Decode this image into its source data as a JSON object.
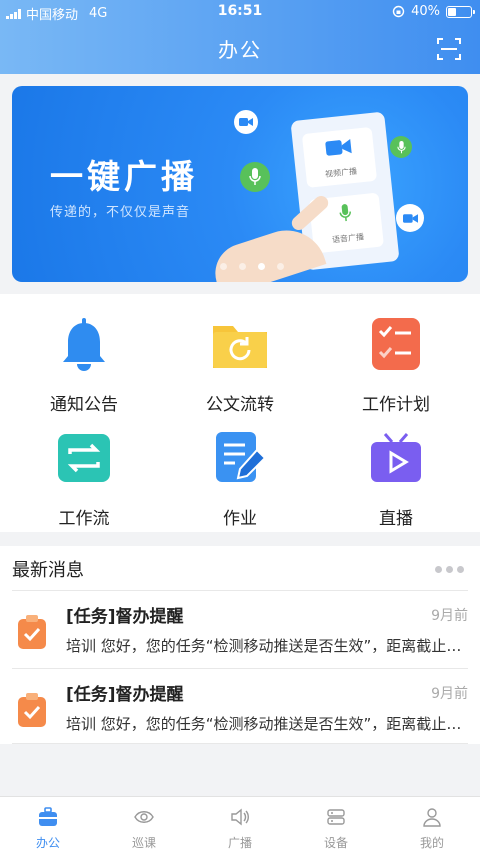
{
  "status_bar": {
    "carrier": "中国移动",
    "network": "4G",
    "time": "16:51",
    "battery": "40%",
    "battery_level": 0.4
  },
  "header": {
    "title": "办公",
    "scan_icon": "scan-icon"
  },
  "banner": {
    "title": "一键广播",
    "subtitle": "传递的，不仅仅是声音",
    "card_items": [
      "视频广播",
      "语音广播"
    ],
    "dots": 4,
    "active_dot": 2
  },
  "grid": {
    "items": [
      {
        "label": "通知公告",
        "icon": "bell-icon",
        "color": "#2f8cf0"
      },
      {
        "label": "公文流转",
        "icon": "folder-refresh-icon",
        "color": "#f7c53a"
      },
      {
        "label": "工作计划",
        "icon": "checklist-icon",
        "color": "#f36b4c"
      },
      {
        "label": "工作流",
        "icon": "workflow-icon",
        "color": "#2bc4b4"
      },
      {
        "label": "作业",
        "icon": "homework-icon",
        "color": "#3a92f2"
      },
      {
        "label": "直播",
        "icon": "tv-live-icon",
        "color": "#7a5ef0"
      }
    ]
  },
  "news": {
    "title": "最新消息",
    "items": [
      {
        "title": "[任务]督办提醒",
        "time": "9月前",
        "body": "培训 您好，您的任务“检测移动推送是否生效”，距离截止时间还有"
      },
      {
        "title": "[任务]督办提醒",
        "time": "9月前",
        "body": "培训 您好，您的任务“检测移动推送是否生效”，距离截止时间还有"
      }
    ]
  },
  "tabbar": {
    "items": [
      {
        "label": "办公",
        "icon": "briefcase-icon",
        "active": true
      },
      {
        "label": "巡课",
        "icon": "eye-icon",
        "active": false
      },
      {
        "label": "广播",
        "icon": "speaker-icon",
        "active": false
      },
      {
        "label": "设备",
        "icon": "device-icon",
        "active": false
      },
      {
        "label": "我的",
        "icon": "user-icon",
        "active": false
      }
    ]
  },
  "colors": {
    "accent": "#3f8ef0",
    "header_start": "#79b8f5",
    "tab_inactive": "#999999"
  }
}
